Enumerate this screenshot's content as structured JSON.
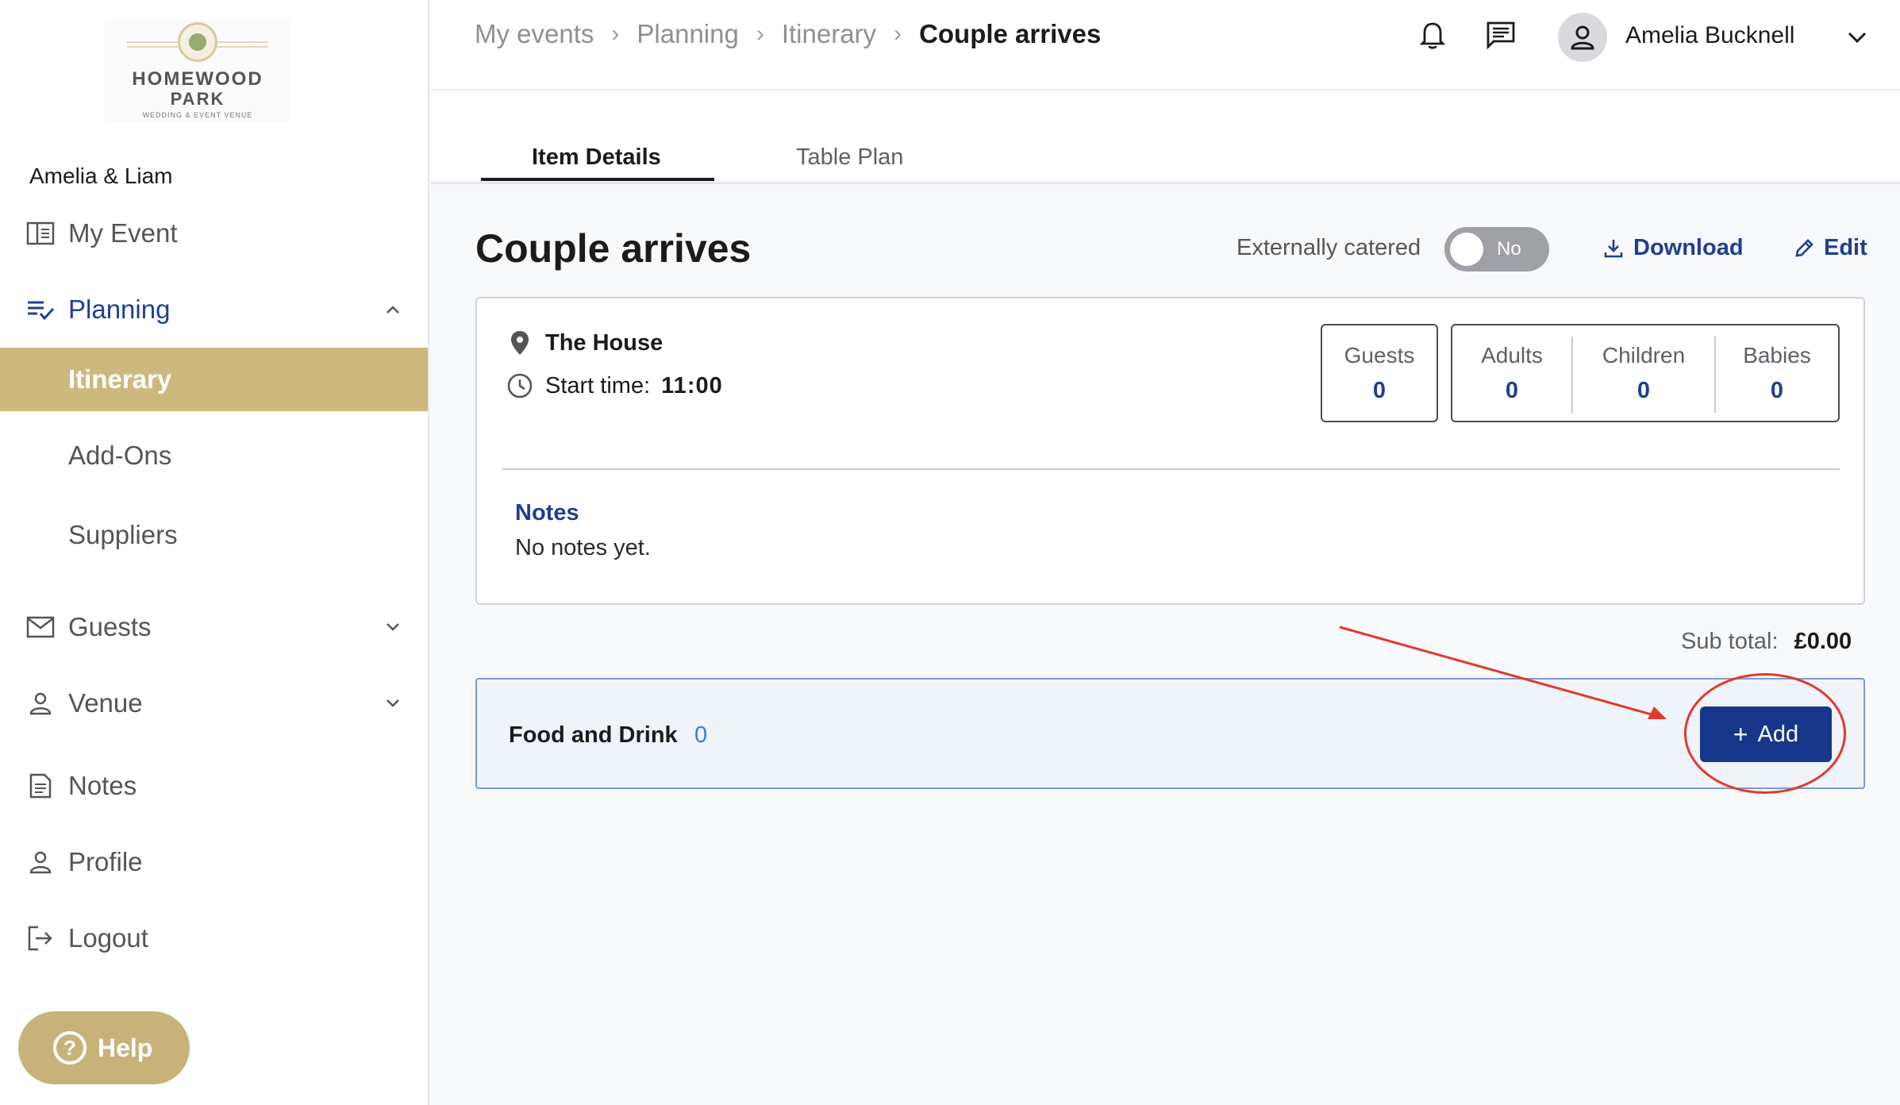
{
  "sidebar": {
    "logo": {
      "line1": "HOMEWOOD",
      "line2": "PARK",
      "line3": "WEDDING & EVENT VENUE"
    },
    "couple_name": "Amelia & Liam",
    "items": [
      {
        "label": "My Event",
        "icon": "book-open-icon"
      },
      {
        "label": "Planning",
        "icon": "checklist-icon",
        "expanded": true
      },
      {
        "label": "Itinerary",
        "active": true
      },
      {
        "label": "Add-Ons"
      },
      {
        "label": "Suppliers"
      },
      {
        "label": "Guests",
        "icon": "envelope-icon"
      },
      {
        "label": "Venue",
        "icon": "person-icon"
      },
      {
        "label": "Notes",
        "icon": "document-icon"
      },
      {
        "label": "Profile",
        "icon": "person-icon"
      },
      {
        "label": "Logout",
        "icon": "logout-icon"
      }
    ],
    "help_label": "Help"
  },
  "topbar": {
    "breadcrumb": [
      "My events",
      "Planning",
      "Itinerary",
      "Couple arrives"
    ],
    "user_name": "Amelia Bucknell"
  },
  "tabs": [
    {
      "label": "Item Details",
      "active": true
    },
    {
      "label": "Table Plan",
      "active": false
    }
  ],
  "main": {
    "title": "Couple arrives",
    "externally_catered_label": "Externally catered",
    "toggle_value": "No",
    "download_label": "Download",
    "edit_label": "Edit",
    "location": "The House",
    "start_time_label": "Start time:",
    "start_time": "11:00",
    "counts": {
      "guests": {
        "label": "Guests",
        "value": "0"
      },
      "adults": {
        "label": "Adults",
        "value": "0"
      },
      "children": {
        "label": "Children",
        "value": "0"
      },
      "babies": {
        "label": "Babies",
        "value": "0"
      }
    },
    "notes_title": "Notes",
    "notes_text": "No notes yet.",
    "subtotal_label": "Sub total:",
    "subtotal_value": "£0.00",
    "food_label": "Food and Drink",
    "food_count": "0",
    "add_label": "Add"
  },
  "colors": {
    "accent": "#1f3f8f",
    "sidebar_active": "#cdb97d",
    "annotation": "#e03a2a"
  }
}
